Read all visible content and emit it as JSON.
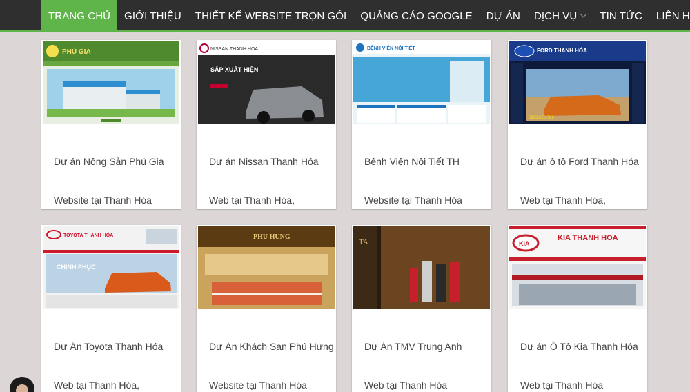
{
  "nav": {
    "items": [
      {
        "label": "TRANG CHỦ"
      },
      {
        "label": "GIỚI THIỆU"
      },
      {
        "label": "THIẾT KẾ WEBSITE TRỌN GÓI"
      },
      {
        "label": "QUẢNG CÁO GOOGLE"
      },
      {
        "label": "DỰ ÁN"
      },
      {
        "label": "DỊCH VỤ"
      },
      {
        "label": "TIN TỨC"
      },
      {
        "label": "LIÊN HỆ"
      }
    ]
  },
  "colors": {
    "accent": "#5fb54a",
    "nav_bg": "#2f2f2f",
    "page_bg": "#dcd6d6"
  },
  "projects": [
    {
      "title": "Dự án Nông Sản Phú Gia",
      "subtitle": "Website tại Thanh Hóa",
      "thumb_text": "PHÚ GIA"
    },
    {
      "title": "Dự án Nissan Thanh Hóa",
      "subtitle": "Web tại Thanh Hóa,",
      "thumb_text": "NISSAN THANH HÓA",
      "thumb_text2": "SẮP XUẤT HIỆN"
    },
    {
      "title": "Bệnh Viện Nội Tiết TH",
      "subtitle": "Website tại Thanh Hóa",
      "thumb_text": "BỆNH VIỆN NỘI TIẾT"
    },
    {
      "title": "Dự án ô tô Ford Thanh Hóa",
      "subtitle": "Web tại Thanh Hóa,",
      "thumb_text": "FORD THANH HÓA",
      "thumb_text2": "0963.658.789"
    },
    {
      "title": "Dự Án Toyota Thanh Hóa",
      "subtitle": "Web tại Thanh Hóa,",
      "thumb_text": "TOYOTA THANH HÓA",
      "thumb_text2": "CHINH PHỤC"
    },
    {
      "title": "Dự Án Khách Sạn Phú Hưng",
      "subtitle": "Website tại Thanh Hóa",
      "thumb_text": "PHU HUNG"
    },
    {
      "title": "Dự Án TMV Trung Anh",
      "subtitle": "Web tại Thanh Hóa",
      "thumb_text": "TA"
    },
    {
      "title": "Dự án Ô Tô Kia Thanh Hóa",
      "subtitle": "Web tại Thanh Hóa",
      "thumb_text": "KIA THANH HOA",
      "thumb_text2": "KIA"
    }
  ]
}
